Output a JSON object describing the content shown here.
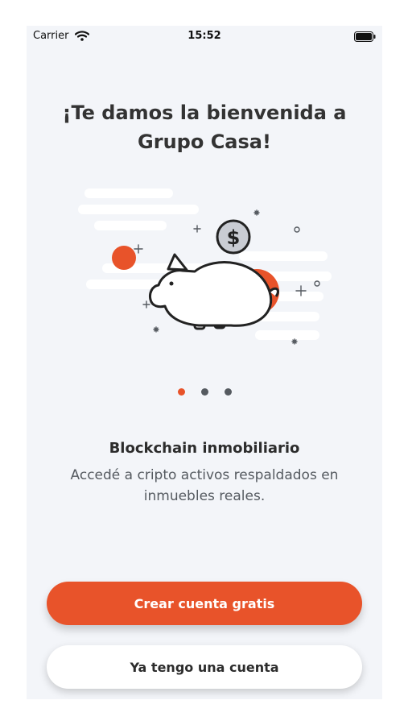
{
  "status_bar": {
    "carrier": "Carrier",
    "time": "15:52",
    "icons": [
      "wifi-icon",
      "battery-icon"
    ]
  },
  "onboarding": {
    "title": "¡Te damos la bienvenida a Grupo Casa!",
    "illustration_icon": "piggy-bank-icon",
    "coin_symbol": "$",
    "pager": {
      "pages": 3,
      "active_index": 0
    },
    "feature_title": "Blockchain inmobiliario",
    "feature_description": "Accedé a cripto activos respaldados en inmuebles reales."
  },
  "actions": {
    "primary_label": "Crear cuenta gratis",
    "secondary_label": "Ya tengo una cuenta"
  },
  "colors": {
    "accent": "#e8532a",
    "background": "#f3f5f9",
    "text_dark": "#2c2c2c",
    "text_muted": "#555a60"
  }
}
